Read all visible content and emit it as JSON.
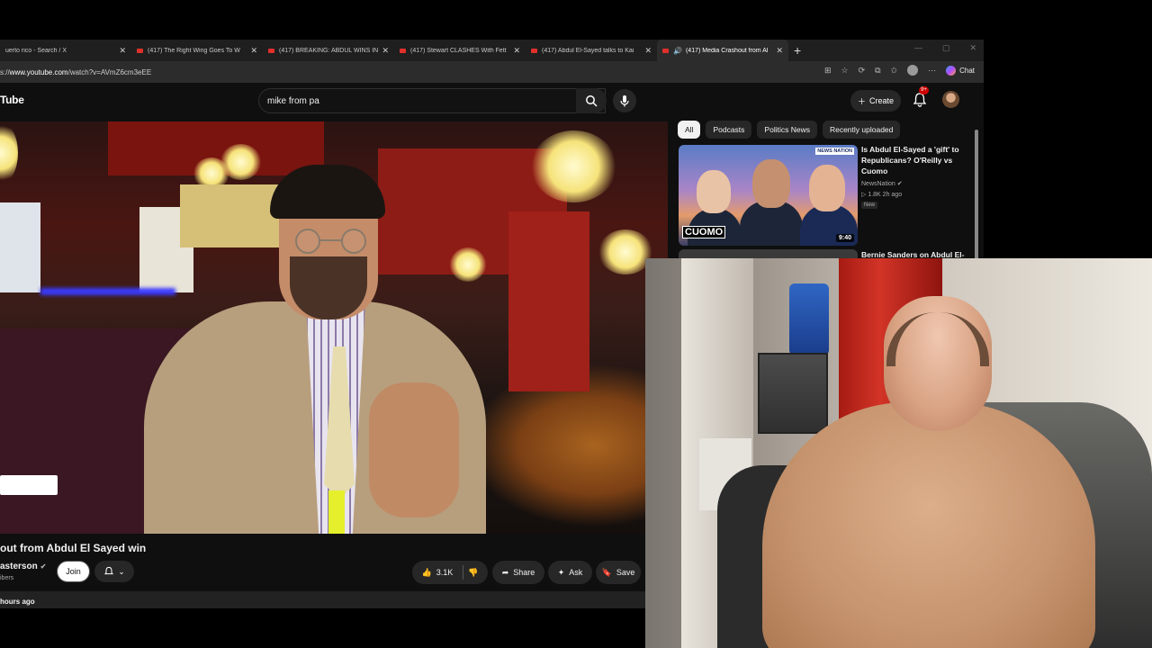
{
  "browser": {
    "tabs": [
      {
        "label": "uerto rico - Search / X",
        "active": false
      },
      {
        "label": "(417) The Right Wing Goes To W",
        "active": false
      },
      {
        "label": "(417) BREAKING: ABDUL WINS IN",
        "active": false
      },
      {
        "label": "(417) Stewart CLASHES With Fett",
        "active": false
      },
      {
        "label": "(417) Abdul El-Sayed talks to Kai",
        "active": false
      },
      {
        "label": "(417) Media Crashout from Al",
        "active": true
      }
    ],
    "new_tab": "+",
    "url_prefix": "s://",
    "url_domain": "www.youtube.com",
    "url_path": "/watch?v=AVmZ6cm3eEE",
    "chat_label": "Chat",
    "accent": "#e0302c"
  },
  "youtube": {
    "logo_text": "Tube",
    "search_value": "mike from pa",
    "create_label": "Create",
    "notification_count": "9+",
    "chips": [
      "All",
      "Podcasts",
      "Politics News",
      "Recently uploaded"
    ]
  },
  "video": {
    "title": "out from Abdul El Sayed win",
    "channel": "asterson",
    "subscribers": "ibers",
    "join_label": "Join",
    "likes": "3.1K",
    "share_label": "Share",
    "ask_label": "Ask",
    "save_label": "Save",
    "age": "hours ago"
  },
  "recommendations": [
    {
      "title": "Is Abdul El-Sayed a 'gift' to Republicans? O'Reilly vs Cuomo",
      "channel": "NewsNation",
      "meta": "▷ 1.8K   2h ago",
      "badge": "New",
      "duration": "9:40",
      "overlay_text": "CUOMO",
      "logo_text": "NEWS NATION"
    },
    {
      "title": "Bernie Sanders on Abdul El-"
    }
  ]
}
